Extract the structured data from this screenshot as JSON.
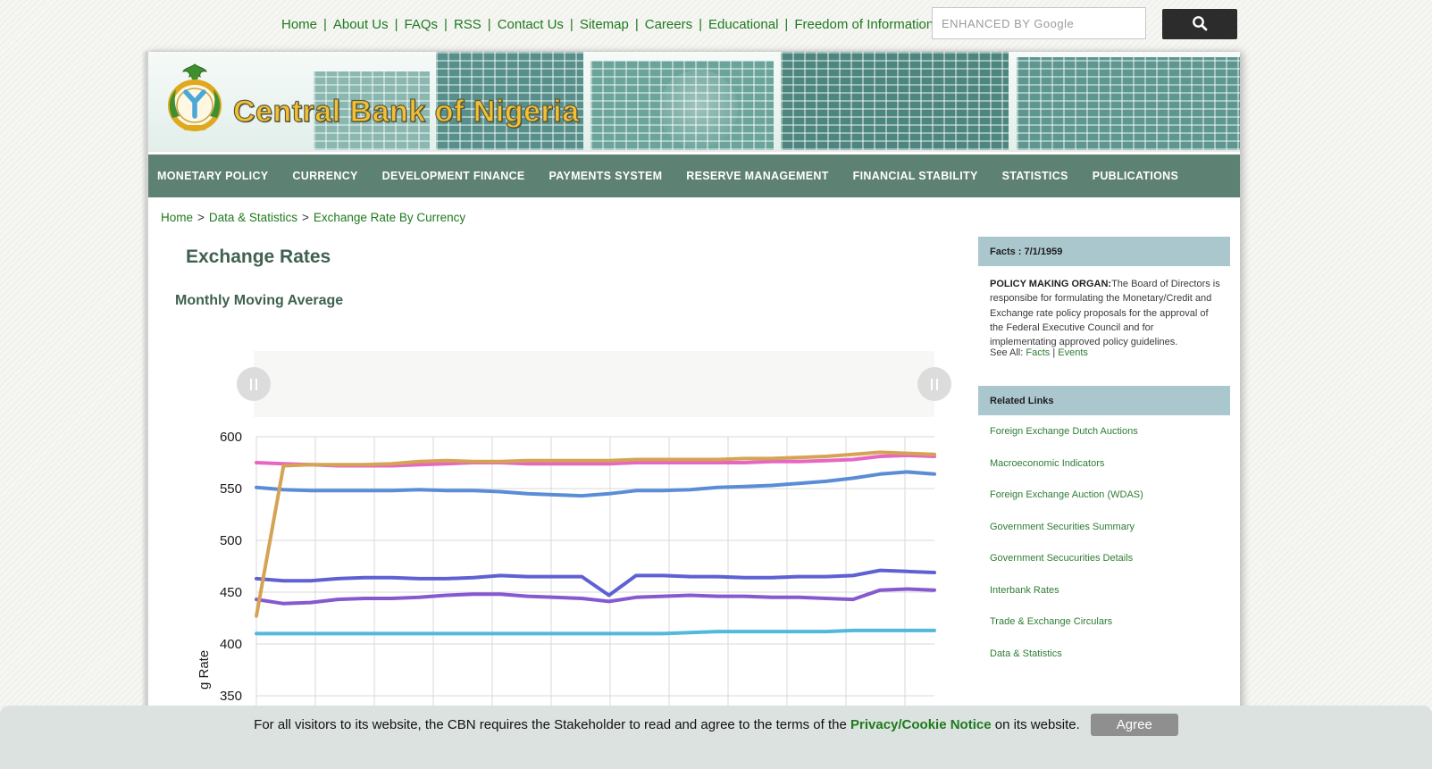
{
  "topbar": {
    "links": [
      "Home",
      "About Us",
      "FAQs",
      "RSS",
      "Contact Us",
      "Sitemap",
      "Careers",
      "Educational",
      "Freedom of Information"
    ],
    "separator": "|",
    "search_placeholder": "ENHANCED BY Google"
  },
  "header": {
    "site_title": "Central Bank of Nigeria"
  },
  "navbar": {
    "items": [
      "MONETARY POLICY",
      "CURRENCY",
      "DEVELOPMENT FINANCE",
      "PAYMENTS SYSTEM",
      "RESERVE MANAGEMENT",
      "FINANCIAL STABILITY",
      "STATISTICS",
      "PUBLICATIONS"
    ]
  },
  "breadcrumb": {
    "items": [
      "Home",
      "Data & Statistics",
      "Exchange Rate By Currency"
    ],
    "separator": ">"
  },
  "page": {
    "title": "Exchange Rates",
    "subtitle": "Monthly Moving Average"
  },
  "chart_data": {
    "type": "line",
    "title": "Monthly Moving Average",
    "ylabel": "g Rate",
    "yticks": [
      600,
      550,
      500,
      450,
      400,
      350
    ],
    "ylim": [
      345,
      615
    ],
    "grid": true,
    "legend_position": "none",
    "series": [
      {
        "name": "series-cyan",
        "color": "#54b8db",
        "values": [
          410,
          410,
          410,
          410,
          410,
          410,
          410,
          410,
          410,
          410,
          410,
          410,
          410,
          410,
          410,
          410,
          411,
          412,
          412,
          412,
          412,
          412,
          413,
          413,
          413,
          413
        ]
      },
      {
        "name": "series-purple",
        "color": "#8659d0",
        "values": [
          443,
          439,
          440,
          443,
          444,
          444,
          445,
          447,
          448,
          448,
          446,
          445,
          444,
          441,
          445,
          446,
          447,
          446,
          446,
          445,
          445,
          444,
          443,
          452,
          453,
          452
        ]
      },
      {
        "name": "series-indigo",
        "color": "#5e61d2",
        "values": [
          463,
          461,
          461,
          463,
          464,
          464,
          463,
          463,
          464,
          466,
          465,
          465,
          465,
          447,
          466,
          466,
          465,
          465,
          464,
          464,
          465,
          465,
          466,
          471,
          470,
          469
        ]
      },
      {
        "name": "series-blue",
        "color": "#5b8dd6",
        "values": [
          551,
          549,
          548,
          548,
          548,
          548,
          549,
          548,
          548,
          547,
          545,
          544,
          543,
          545,
          548,
          548,
          549,
          551,
          552,
          553,
          555,
          557,
          560,
          564,
          566,
          564
        ]
      },
      {
        "name": "series-pink",
        "color": "#e667c3",
        "values": [
          575,
          574,
          573,
          572,
          572,
          572,
          573,
          574,
          575,
          575,
          574,
          574,
          574,
          574,
          575,
          575,
          575,
          575,
          575,
          576,
          576,
          577,
          578,
          581,
          582,
          581
        ]
      },
      {
        "name": "series-orange",
        "color": "#d6a355",
        "values": [
          427,
          572,
          573,
          573,
          573,
          574,
          576,
          577,
          576,
          576,
          577,
          577,
          577,
          577,
          578,
          578,
          578,
          578,
          579,
          579,
          580,
          581,
          583,
          585,
          584,
          583
        ]
      }
    ]
  },
  "sidebar": {
    "facts": {
      "header": "Facts : 7/1/1959",
      "lead": "POLICY MAKING ORGAN:",
      "body": "The Board of Directors is responsibe for formulating the Monetary/Credit and Exchange rate policy proposals for the approval of the Federal Executive Council and for implementating approved policy guidelines.",
      "see_all_label": "See All:",
      "see_all_links": [
        "Facts",
        "Events"
      ],
      "see_all_separator": "|"
    },
    "related": {
      "header": "Related Links",
      "links": [
        "Foreign Exchange Dutch Auctions",
        "Macroeconomic Indicators",
        "Foreign Exchange Auction (WDAS)",
        "Government Securities Summary",
        "Government Secucurities Details",
        "Interbank Rates",
        "Trade & Exchange Circulars",
        "Data & Statistics"
      ]
    }
  },
  "cookie": {
    "text_pre": "For all visitors to its website, the CBN requires the Stakeholder to read and agree to the terms of the ",
    "link": "Privacy/Cookie Notice",
    "text_post": " on its website.",
    "button": "Agree"
  }
}
